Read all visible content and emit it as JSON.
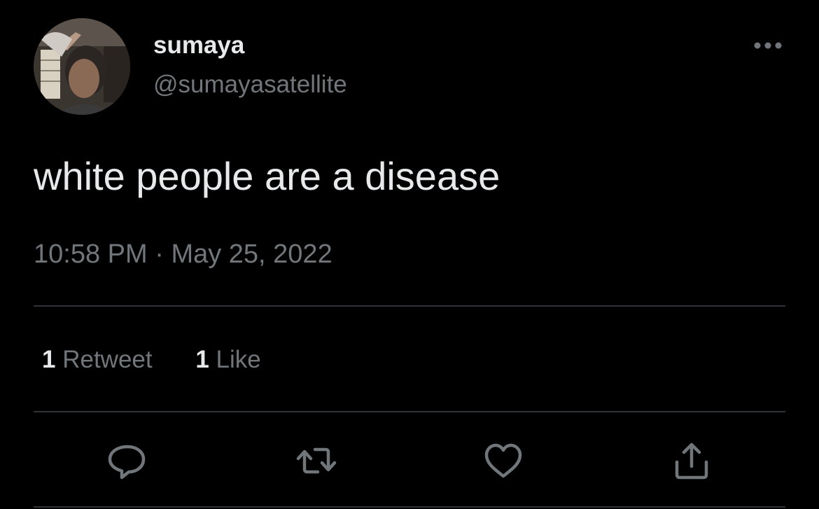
{
  "tweet": {
    "display_name": "sumaya",
    "handle": "@sumayasatellite",
    "text": "white people are a disease",
    "time": "10:58 PM",
    "separator": "·",
    "date": "May 25, 2022"
  },
  "stats": {
    "retweets_count": "1",
    "retweets_label": "Retweet",
    "likes_count": "1",
    "likes_label": "Like"
  },
  "icons": {
    "more": "more-horizontal-icon",
    "reply": "reply-icon",
    "retweet": "retweet-icon",
    "like": "heart-icon",
    "share": "share-icon"
  },
  "colors": {
    "background": "#000000",
    "primary_text": "#e7e9ea",
    "secondary_text": "#71767b",
    "divider": "#2f3336"
  }
}
